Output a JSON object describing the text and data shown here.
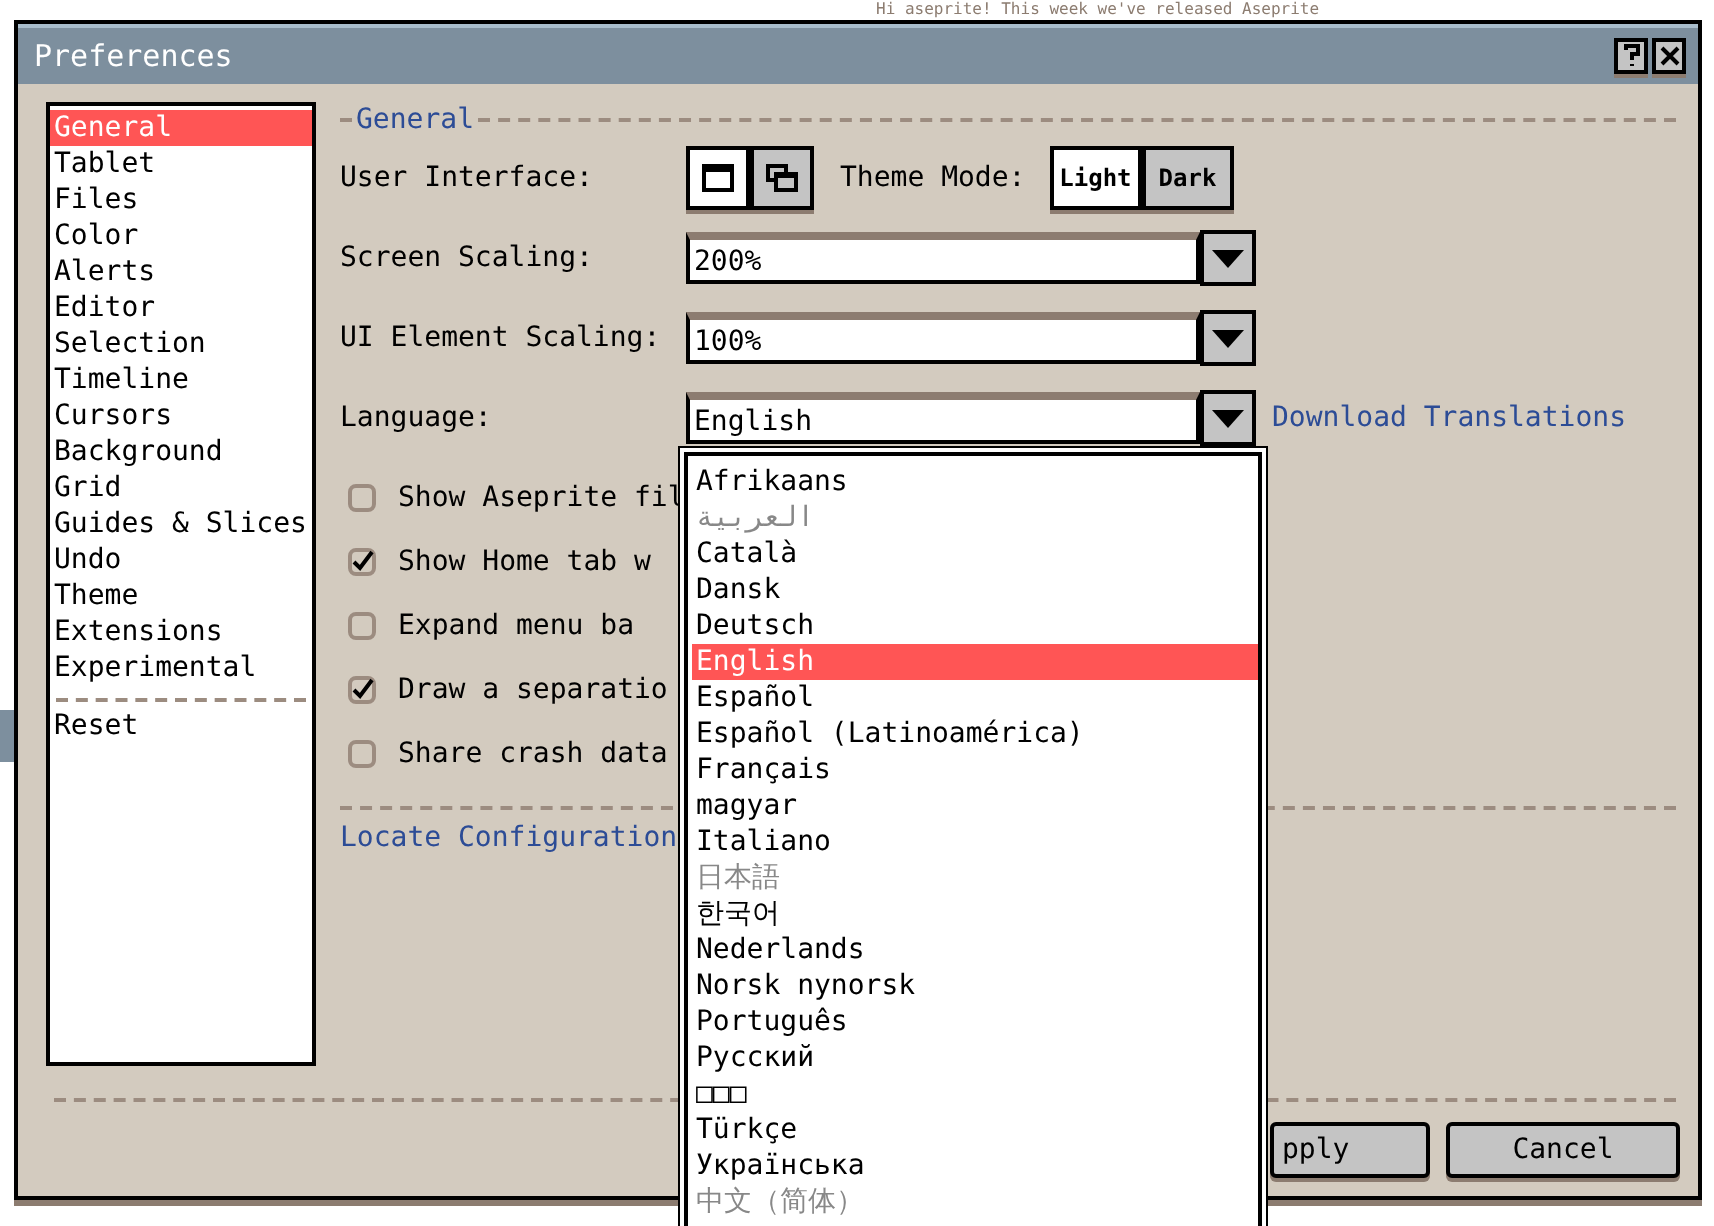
{
  "background": {
    "text": "Hi aseprite! This week we've released Aseprite"
  },
  "window": {
    "title": "Preferences"
  },
  "sidebar": {
    "items": [
      {
        "label": "General",
        "selected": true
      },
      {
        "label": "Tablet",
        "selected": false
      },
      {
        "label": "Files",
        "selected": false
      },
      {
        "label": "Color",
        "selected": false
      },
      {
        "label": "Alerts",
        "selected": false
      },
      {
        "label": "Editor",
        "selected": false
      },
      {
        "label": "Selection",
        "selected": false
      },
      {
        "label": "Timeline",
        "selected": false
      },
      {
        "label": "Cursors",
        "selected": false
      },
      {
        "label": "Background",
        "selected": false
      },
      {
        "label": "Grid",
        "selected": false
      },
      {
        "label": "Guides & Slices",
        "selected": false
      },
      {
        "label": "Undo",
        "selected": false
      },
      {
        "label": "Theme",
        "selected": false
      },
      {
        "label": "Extensions",
        "selected": false
      },
      {
        "label": "Experimental",
        "selected": false
      }
    ],
    "footer_items": [
      {
        "label": "Reset",
        "selected": false
      }
    ]
  },
  "section": {
    "title": "General"
  },
  "user_interface": {
    "label": "User Interface:",
    "options": [
      {
        "kind": "single",
        "selected": true
      },
      {
        "kind": "multiple",
        "selected": false
      }
    ]
  },
  "theme_mode": {
    "label": "Theme Mode:",
    "options": [
      {
        "label": "Light",
        "selected": true
      },
      {
        "label": "Dark",
        "selected": false
      }
    ]
  },
  "screen_scaling": {
    "label": "Screen Scaling:",
    "value": "200%"
  },
  "ui_element_scaling": {
    "label": "UI Element Scaling:",
    "value": "100%"
  },
  "language": {
    "label": "Language:",
    "value": "English",
    "link": "Download Translations"
  },
  "checkboxes": [
    {
      "label": "Show Aseprite fil",
      "checked": false
    },
    {
      "label": "Show Home tab w",
      "checked": true
    },
    {
      "label": "Expand menu ba",
      "checked": false
    },
    {
      "label": "Draw a separatio",
      "checked": true
    },
    {
      "label": "Share crash data",
      "checked": false
    }
  ],
  "locate_link": "Locate Configuration",
  "language_list": {
    "items": [
      {
        "label": "Afrikaans",
        "selected": false,
        "dimmed": false
      },
      {
        "label": "العربية",
        "selected": false,
        "dimmed": true
      },
      {
        "label": "Català",
        "selected": false,
        "dimmed": false
      },
      {
        "label": "Dansk",
        "selected": false,
        "dimmed": false
      },
      {
        "label": "Deutsch",
        "selected": false,
        "dimmed": false
      },
      {
        "label": "English",
        "selected": true,
        "dimmed": false
      },
      {
        "label": "Español",
        "selected": false,
        "dimmed": false
      },
      {
        "label": "Español (Latinoamérica)",
        "selected": false,
        "dimmed": false
      },
      {
        "label": "Français",
        "selected": false,
        "dimmed": false
      },
      {
        "label": "magyar",
        "selected": false,
        "dimmed": false
      },
      {
        "label": "Italiano",
        "selected": false,
        "dimmed": false
      },
      {
        "label": "日本語",
        "selected": false,
        "dimmed": true
      },
      {
        "label": "한국어",
        "selected": false,
        "dimmed": false
      },
      {
        "label": "Nederlands",
        "selected": false,
        "dimmed": false
      },
      {
        "label": "Norsk nynorsk",
        "selected": false,
        "dimmed": false
      },
      {
        "label": "Português",
        "selected": false,
        "dimmed": false
      },
      {
        "label": "Русский",
        "selected": false,
        "dimmed": false
      },
      {
        "label": "□□□",
        "selected": false,
        "dimmed": false
      },
      {
        "label": "Türkçe",
        "selected": false,
        "dimmed": false
      },
      {
        "label": "Українська",
        "selected": false,
        "dimmed": false
      },
      {
        "label": "中文（简体）",
        "selected": false,
        "dimmed": true
      }
    ]
  },
  "buttons": [
    {
      "label": "pply"
    },
    {
      "label": "Cancel"
    }
  ]
}
